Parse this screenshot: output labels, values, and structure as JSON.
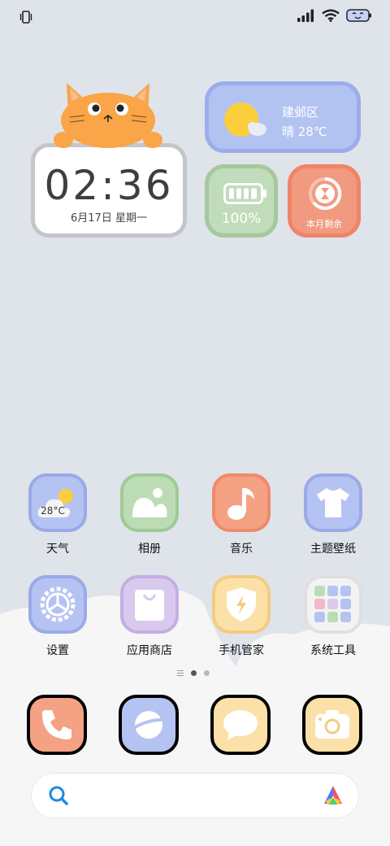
{
  "status_bar": {
    "vibrate_icon": "vibrate-icon",
    "signal_icon": "signal-icon",
    "wifi_icon": "wifi-icon",
    "battery_icon": "battery-face-icon"
  },
  "widgets": {
    "clock": {
      "time": "02:36",
      "date": "6月17日 星期一"
    },
    "weather": {
      "location": "建邺区",
      "condition": "晴 28℃"
    },
    "battery": {
      "percent": "100%"
    },
    "month": {
      "label": "本月剩余"
    }
  },
  "apps": [
    {
      "label": "天气",
      "icon": "weather-icon",
      "badge": "28°C"
    },
    {
      "label": "相册",
      "icon": "gallery-icon"
    },
    {
      "label": "音乐",
      "icon": "music-icon"
    },
    {
      "label": "主题壁纸",
      "icon": "theme-icon"
    },
    {
      "label": "设置",
      "icon": "settings-icon"
    },
    {
      "label": "应用商店",
      "icon": "app-store-icon"
    },
    {
      "label": "手机管家",
      "icon": "security-icon"
    },
    {
      "label": "系统工具",
      "icon": "tools-folder-icon"
    }
  ],
  "pager": {
    "pages": 2,
    "active": 1
  },
  "dock": [
    {
      "icon": "phone-icon"
    },
    {
      "icon": "browser-icon"
    },
    {
      "icon": "messages-icon"
    },
    {
      "icon": "camera-icon"
    }
  ],
  "search": {
    "icon": "search-icon",
    "assistant_icon": "assistant-icon"
  },
  "colors": {
    "background": "#dfe3ea",
    "blue": "#b5c3f2",
    "green": "#bcdcb6",
    "orange": "#f4a184",
    "purple": "#d9c9ee",
    "yellow": "#fbe1a8"
  }
}
